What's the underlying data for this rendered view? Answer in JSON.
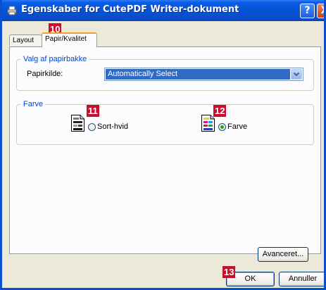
{
  "window": {
    "title": "Egenskaber for CutePDF Writer-dokument"
  },
  "titlebar": {
    "help_label": "?",
    "close_label": "X"
  },
  "tabs": [
    {
      "label": "Layout",
      "active": false
    },
    {
      "label": "Papir/Kvalitet",
      "active": true
    }
  ],
  "paper_group": {
    "legend": "Valg af papirbakke",
    "source_label": "Papirkilde:",
    "source_value": "Automatically Select"
  },
  "color_group": {
    "legend": "Farve",
    "options": [
      {
        "label": "Sort-hvid",
        "selected": false
      },
      {
        "label": "Farve",
        "selected": true
      }
    ]
  },
  "buttons": {
    "advanced": "Avanceret...",
    "ok": "OK",
    "cancel": "Annuller"
  },
  "annotations": {
    "tab": "10",
    "bw": "11",
    "color": "12",
    "ok": "13"
  },
  "colors": {
    "accent": "#0046d5",
    "badge": "#c8102e",
    "title_bar": "#0653d6"
  }
}
